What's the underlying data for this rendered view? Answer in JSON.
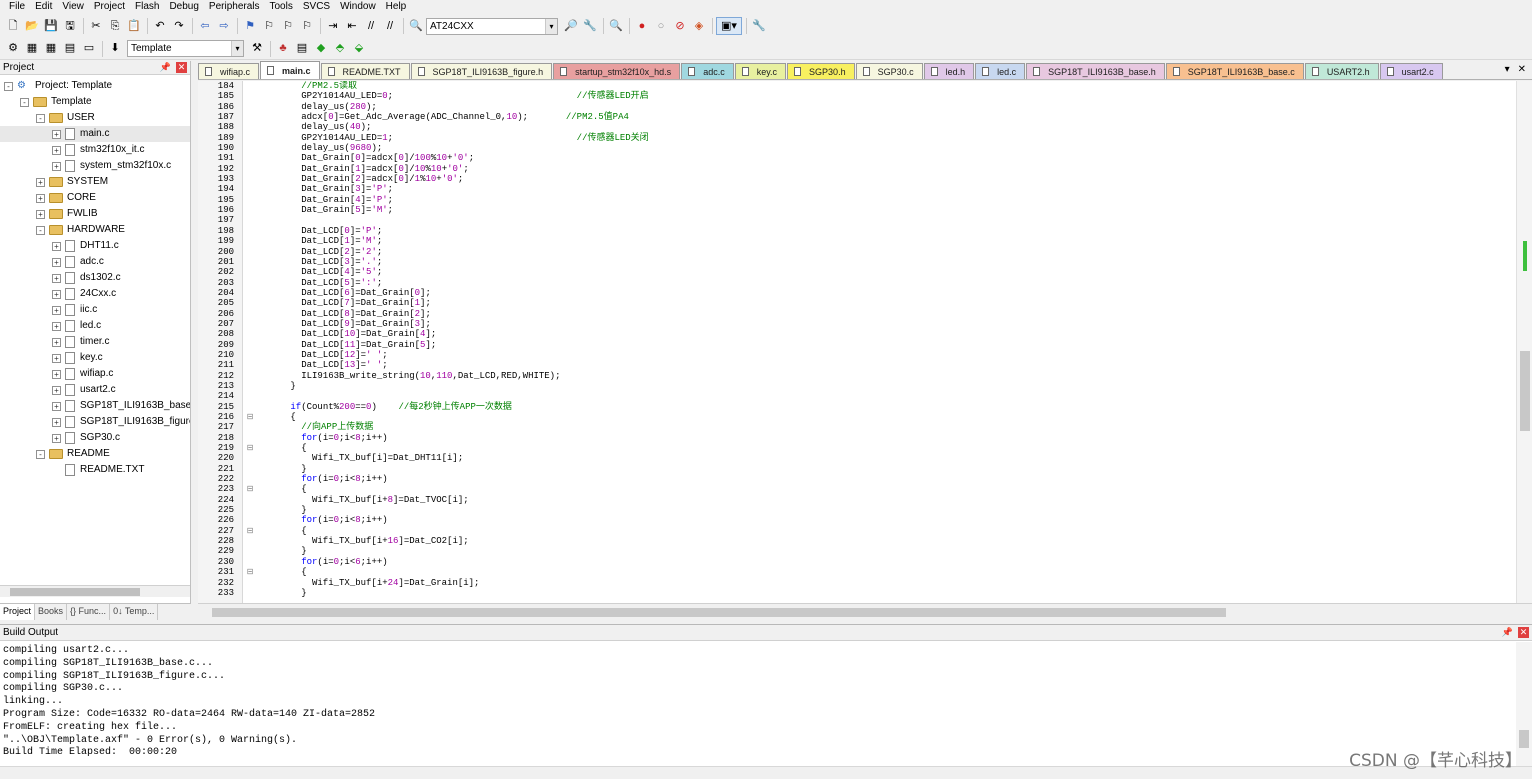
{
  "menu": [
    "File",
    "Edit",
    "View",
    "Project",
    "Flash",
    "Debug",
    "Peripherals",
    "Tools",
    "SVCS",
    "Window",
    "Help"
  ],
  "toolbar": {
    "target_combo": "AT24CXX",
    "build_target": "Template"
  },
  "colors": {
    "accent": "#0000ff",
    "comment": "#008000",
    "number": "#a000a0"
  },
  "project_panel": {
    "title": "Project",
    "tree": [
      {
        "label": "Project: Template",
        "level": 0,
        "kind": "project",
        "exp": "-"
      },
      {
        "label": "Template",
        "level": 1,
        "kind": "folder",
        "exp": "-"
      },
      {
        "label": "USER",
        "level": 2,
        "kind": "folder",
        "exp": "-"
      },
      {
        "label": "main.c",
        "level": 3,
        "kind": "file",
        "exp": "+"
      },
      {
        "label": "stm32f10x_it.c",
        "level": 3,
        "kind": "file",
        "exp": "+"
      },
      {
        "label": "system_stm32f10x.c",
        "level": 3,
        "kind": "file",
        "exp": "+"
      },
      {
        "label": "SYSTEM",
        "level": 2,
        "kind": "folder",
        "exp": "+"
      },
      {
        "label": "CORE",
        "level": 2,
        "kind": "folder",
        "exp": "+"
      },
      {
        "label": "FWLIB",
        "level": 2,
        "kind": "folder",
        "exp": "+"
      },
      {
        "label": "HARDWARE",
        "level": 2,
        "kind": "folder",
        "exp": "-"
      },
      {
        "label": "DHT11.c",
        "level": 3,
        "kind": "file",
        "exp": "+"
      },
      {
        "label": "adc.c",
        "level": 3,
        "kind": "file",
        "exp": "+"
      },
      {
        "label": "ds1302.c",
        "level": 3,
        "kind": "file",
        "exp": "+"
      },
      {
        "label": "24Cxx.c",
        "level": 3,
        "kind": "file",
        "exp": "+"
      },
      {
        "label": "iic.c",
        "level": 3,
        "kind": "file",
        "exp": "+"
      },
      {
        "label": "led.c",
        "level": 3,
        "kind": "file",
        "exp": "+"
      },
      {
        "label": "timer.c",
        "level": 3,
        "kind": "file",
        "exp": "+"
      },
      {
        "label": "key.c",
        "level": 3,
        "kind": "file",
        "exp": "+"
      },
      {
        "label": "wifiap.c",
        "level": 3,
        "kind": "file",
        "exp": "+"
      },
      {
        "label": "usart2.c",
        "level": 3,
        "kind": "file",
        "exp": "+"
      },
      {
        "label": "SGP18T_ILI9163B_base.c",
        "level": 3,
        "kind": "file",
        "exp": "+"
      },
      {
        "label": "SGP18T_ILI9163B_figure.c",
        "level": 3,
        "kind": "file",
        "exp": "+"
      },
      {
        "label": "SGP30.c",
        "level": 3,
        "kind": "file",
        "exp": "+"
      },
      {
        "label": "README",
        "level": 2,
        "kind": "folder",
        "exp": "-"
      },
      {
        "label": "README.TXT",
        "level": 3,
        "kind": "file",
        "exp": ""
      }
    ],
    "tabs": [
      "Project",
      "Books",
      "{} Func...",
      "0↓ Temp..."
    ]
  },
  "file_tabs": [
    {
      "label": "wifiap.c",
      "color": "#f6f6e0"
    },
    {
      "label": "main.c",
      "color": "#ffffff",
      "active": true
    },
    {
      "label": "README.TXT",
      "color": "#f6f6e0"
    },
    {
      "label": "SGP18T_ILI9163B_figure.h",
      "color": "#f6f6e0"
    },
    {
      "label": "startup_stm32f10x_hd.s",
      "color": "#e8a0a0"
    },
    {
      "label": "adc.c",
      "color": "#a0d8e0"
    },
    {
      "label": "key.c",
      "color": "#e8f0a0"
    },
    {
      "label": "SGP30.h",
      "color": "#f8f060"
    },
    {
      "label": "SGP30.c",
      "color": "#f6f6e0"
    },
    {
      "label": "led.h",
      "color": "#e0c8e8"
    },
    {
      "label": "led.c",
      "color": "#c8d8f0"
    },
    {
      "label": "SGP18T_ILI9163B_base.h",
      "color": "#e8c8e0"
    },
    {
      "label": "SGP18T_ILI9163B_base.c",
      "color": "#f8c090"
    },
    {
      "label": "USART2.h",
      "color": "#c0e8d8"
    },
    {
      "label": "usart2.c",
      "color": "#d8c8f0"
    }
  ],
  "code": {
    "start": 184,
    "lines": [
      "        //PM2.5读取",
      "        GP2Y1014AU_LED=0;                                  //传感器LED开启",
      "        delay_us(280);",
      "        adcx[0]=Get_Adc_Average(ADC_Channel_0,10);       //PM2.5值PA4",
      "        delay_us(40);",
      "        GP2Y1014AU_LED=1;                                  //传感器LED关闭",
      "        delay_us(9680);",
      "        Dat_Grain[0]=adcx[0]/100%10+'0';",
      "        Dat_Grain[1]=adcx[0]/10%10+'0';",
      "        Dat_Grain[2]=adcx[0]/1%10+'0';",
      "        Dat_Grain[3]='P';",
      "        Dat_Grain[4]='P';",
      "        Dat_Grain[5]='M';",
      "",
      "        Dat_LCD[0]='P';",
      "        Dat_LCD[1]='M';",
      "        Dat_LCD[2]='2';",
      "        Dat_LCD[3]='.';",
      "        Dat_LCD[4]='5';",
      "        Dat_LCD[5]=':';",
      "        Dat_LCD[6]=Dat_Grain[0];",
      "        Dat_LCD[7]=Dat_Grain[1];",
      "        Dat_LCD[8]=Dat_Grain[2];",
      "        Dat_LCD[9]=Dat_Grain[3];",
      "        Dat_LCD[10]=Dat_Grain[4];",
      "        Dat_LCD[11]=Dat_Grain[5];",
      "        Dat_LCD[12]=' ';",
      "        Dat_LCD[13]=' ';",
      "        ILI9163B_write_string(10,110,Dat_LCD,RED,WHITE);",
      "      }",
      "",
      "      if(Count%200==0)    //每2秒钟上传APP一次数据",
      "      {",
      "        //向APP上传数据",
      "        for(i=0;i<8;i++)",
      "        {",
      "          Wifi_TX_buf[i]=Dat_DHT11[i];",
      "        }",
      "        for(i=0;i<8;i++)",
      "        {",
      "          Wifi_TX_buf[i+8]=Dat_TVOC[i];",
      "        }",
      "        for(i=0;i<8;i++)",
      "        {",
      "          Wifi_TX_buf[i+16]=Dat_CO2[i];",
      "        }",
      "        for(i=0;i<6;i++)",
      "        {",
      "          Wifi_TX_buf[i+24]=Dat_Grain[i];",
      "        }"
    ],
    "numbers": [
      "184",
      "185",
      "186",
      "187",
      "188",
      "189",
      "190",
      "191",
      "192",
      "193",
      "194",
      "195",
      "196",
      "197",
      "198",
      "199",
      "200",
      "201",
      "202",
      "203",
      "204",
      "205",
      "206",
      "207",
      "208",
      "209",
      "210",
      "211",
      "212",
      "213",
      "214",
      "215",
      "216",
      "217",
      "218",
      "219",
      "220",
      "221",
      "222",
      "223",
      "224",
      "225",
      "226",
      "227",
      "228",
      "229",
      "230",
      "231",
      "232",
      "233"
    ]
  },
  "build_output": {
    "title": "Build Output",
    "lines": [
      "compiling usart2.c...",
      "compiling SGP18T_ILI9163B_base.c...",
      "compiling SGP18T_ILI9163B_figure.c...",
      "compiling SGP30.c...",
      "linking...",
      "Program Size: Code=16332 RO-data=2464 RW-data=140 ZI-data=2852",
      "FromELF: creating hex file...",
      "\"..\\OBJ\\Template.axf\" - 0 Error(s), 0 Warning(s).",
      "Build Time Elapsed:  00:00:20"
    ]
  },
  "watermark": "CSDN @【芊心科技】"
}
